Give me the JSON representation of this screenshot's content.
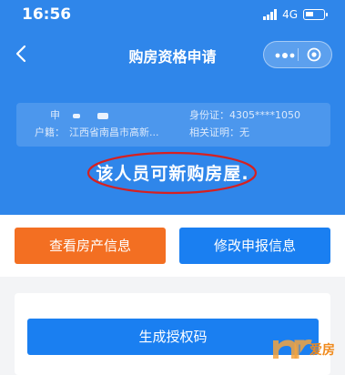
{
  "status_bar": {
    "time": "16:56",
    "network": "4G"
  },
  "nav": {
    "title": "购房资格申请"
  },
  "info": {
    "name_label": "申",
    "id_label": "身份证：",
    "id_value": "4305****1050",
    "census_label": "户籍：",
    "census_value": "江西省南昌市高新...",
    "proof_label": "相关证明：",
    "proof_value": "无"
  },
  "result_text": "该人员可新购房屋.",
  "buttons": {
    "view_property": "查看房产信息",
    "modify_report": "修改申报信息",
    "generate_code": "生成授权码"
  },
  "watermark": {
    "brand": "爱房"
  },
  "colors": {
    "primary": "#2f86ea",
    "orange": "#f36f22",
    "button_blue": "#1a7ff1",
    "ellipse": "#d62020"
  }
}
